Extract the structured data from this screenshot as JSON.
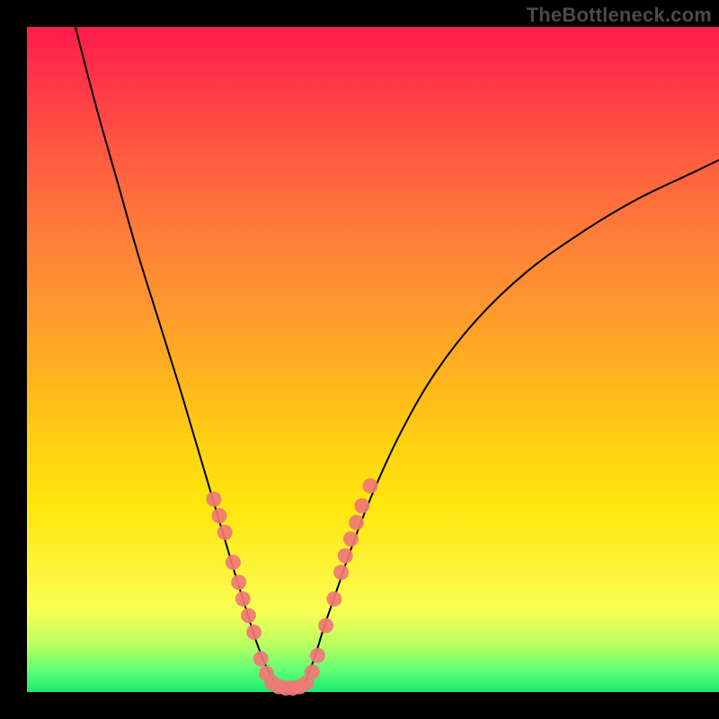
{
  "watermark": "TheBottleneck.com",
  "chart_data": {
    "type": "line",
    "title": "",
    "xlabel": "",
    "ylabel": "",
    "xlim": [
      0,
      100
    ],
    "ylim": [
      0,
      100
    ],
    "grid": false,
    "legend": false,
    "series": [
      {
        "name": "left-curve",
        "color": "#000000",
        "x": [
          7,
          10,
          13,
          16,
          19,
          22,
          24,
          26,
          28,
          30,
          31.5,
          33,
          34.5,
          36
        ],
        "y": [
          100,
          88,
          77,
          66,
          56,
          46,
          39,
          32,
          25,
          18,
          13,
          8,
          4,
          1
        ]
      },
      {
        "name": "right-curve",
        "color": "#000000",
        "x": [
          40,
          41.5,
          43,
          45,
          47,
          50,
          54,
          59,
          65,
          72,
          80,
          88,
          96,
          100
        ],
        "y": [
          1,
          5,
          10,
          16,
          22,
          30,
          39,
          48,
          56,
          63,
          69,
          74,
          78,
          80
        ]
      },
      {
        "name": "valley-floor",
        "color": "#000000",
        "x": [
          36,
          37,
          38,
          39,
          40
        ],
        "y": [
          1,
          0.6,
          0.5,
          0.6,
          1
        ]
      }
    ],
    "markers": {
      "name": "highlight-dots",
      "color": "#f07876",
      "radius_pct": 1.1,
      "points": [
        {
          "x": 27.0,
          "y": 29.0
        },
        {
          "x": 27.8,
          "y": 26.5
        },
        {
          "x": 28.6,
          "y": 24.0
        },
        {
          "x": 29.8,
          "y": 19.5
        },
        {
          "x": 30.6,
          "y": 16.5
        },
        {
          "x": 31.2,
          "y": 14.0
        },
        {
          "x": 32.0,
          "y": 11.5
        },
        {
          "x": 32.8,
          "y": 9.0
        },
        {
          "x": 33.8,
          "y": 5.0
        },
        {
          "x": 34.6,
          "y": 2.8
        },
        {
          "x": 35.4,
          "y": 1.4
        },
        {
          "x": 36.4,
          "y": 0.8
        },
        {
          "x": 37.4,
          "y": 0.6
        },
        {
          "x": 38.4,
          "y": 0.6
        },
        {
          "x": 39.4,
          "y": 0.8
        },
        {
          "x": 40.4,
          "y": 1.4
        },
        {
          "x": 41.2,
          "y": 3.0
        },
        {
          "x": 42.0,
          "y": 5.5
        },
        {
          "x": 43.2,
          "y": 10.0
        },
        {
          "x": 44.4,
          "y": 14.0
        },
        {
          "x": 45.4,
          "y": 18.0
        },
        {
          "x": 46.0,
          "y": 20.5
        },
        {
          "x": 46.8,
          "y": 23.0
        },
        {
          "x": 47.6,
          "y": 25.5
        },
        {
          "x": 48.4,
          "y": 28.0
        },
        {
          "x": 49.6,
          "y": 31.0
        }
      ]
    }
  }
}
